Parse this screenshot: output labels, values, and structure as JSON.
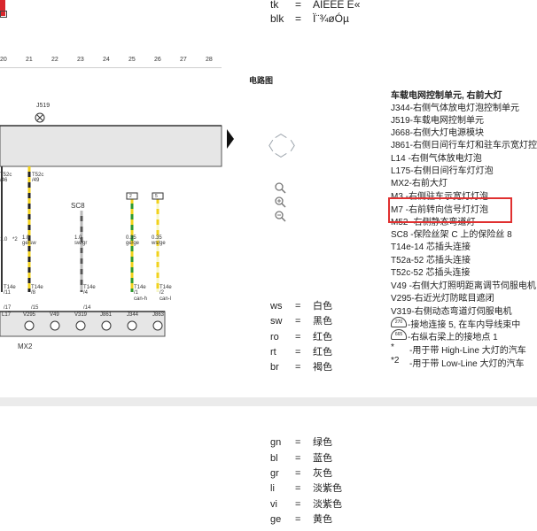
{
  "top_codes": [
    {
      "code": "tk",
      "eq": "=",
      "value": "AIEEE  E«"
    },
    {
      "code": "blk",
      "eq": "=",
      "value": "Ï¨¾øÓµ"
    }
  ],
  "ruler": [
    "20",
    "21",
    "22",
    "23",
    "24",
    "25",
    "26",
    "27",
    "28"
  ],
  "section_title": "电路图",
  "schematic": {
    "module_label": "J519",
    "top_box_label": "2",
    "connectors": [
      "T52c\n/46",
      "T52c\n/49"
    ],
    "sc_label": "SC8",
    "wire_labels": [
      "1.0",
      "1.0\nge/sw",
      "1.0\nsw/gr",
      "0.35\nge/ge",
      "0.35\nws/ge"
    ],
    "bottom_conn": [
      "T14e\n/11",
      "T14e\n/8",
      "T14e\n/4",
      "T14e\n/1",
      "T14e\n/2"
    ],
    "pins": [
      "/17",
      "/15",
      "/14",
      "/13",
      "/1",
      "can-h",
      "can-l"
    ],
    "bottom_names": [
      "L17",
      "V295",
      "V49",
      "V319",
      "J861",
      "J344",
      "J863"
    ],
    "mx2": "MX2",
    "star2": "*2",
    "box_nums": [
      "2",
      "5"
    ]
  },
  "legend_title": "车载电网控制单元, 右前大灯",
  "legend": [
    "J344-右侧气体放电灯泡控制单元",
    "J519-车载电网控制单元",
    "J668-右侧大灯电源模块",
    "J861-右侧日间行车灯和驻车示宽灯控制单元",
    "L14  -右侧气体放电灯泡",
    "L175-右侧日间行车灯灯泡",
    "MX2-右前大灯",
    "M3  -右侧驻车示宽灯灯泡",
    "M7  -右前转向信号灯灯泡",
    "M52 -右侧静态弯道灯",
    "SC8 -保险丝架 C 上的保险丝 8",
    "T14e-14 芯插头连接",
    "T52a-52 芯插头连接",
    "T52c-52 芯插头连接",
    "V49 -右侧大灯照明距离调节伺服电机",
    "V295-右近光灯防眩目遮闭",
    "V319-右侧动态弯道灯伺服电机",
    "-接地连接 5, 在车内导线束中",
    "-右纵右梁上的接地点 1",
    "-用于带 High-Line 大灯的汽车",
    "-用于带 Low-Line 大灯的汽车"
  ],
  "legend_marks": [
    "*",
    "*2"
  ],
  "ground_icons": [
    "270",
    "665"
  ],
  "colors_mid": [
    {
      "code": "ws",
      "eq": "=",
      "name": "白色"
    },
    {
      "code": "sw",
      "eq": "=",
      "name": "黑色"
    },
    {
      "code": "ro",
      "eq": "=",
      "name": "红色"
    },
    {
      "code": "rt",
      "eq": "=",
      "name": "红色"
    },
    {
      "code": "br",
      "eq": "=",
      "name": "褐色"
    }
  ],
  "colors_bottom": [
    {
      "code": "gn",
      "eq": "=",
      "name": "绿色"
    },
    {
      "code": "bl",
      "eq": "=",
      "name": "蓝色"
    },
    {
      "code": "gr",
      "eq": "=",
      "name": "灰色"
    },
    {
      "code": "li",
      "eq": "=",
      "name": "淡紫色"
    },
    {
      "code": "vi",
      "eq": "=",
      "name": "淡紫色"
    },
    {
      "code": "ge",
      "eq": "=",
      "name": "黄色"
    }
  ],
  "accent_red": "#e03030"
}
